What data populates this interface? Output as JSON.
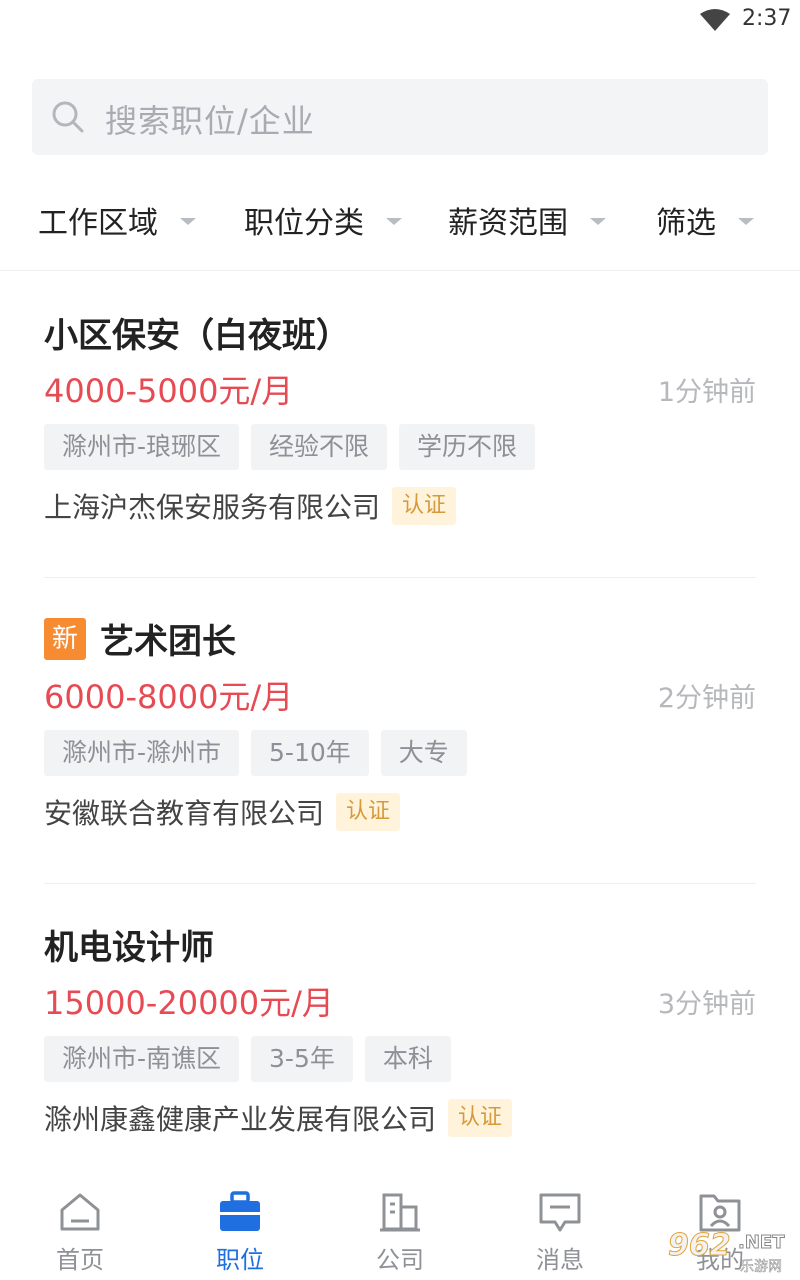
{
  "status_bar": {
    "time": "2:37",
    "wifi_icon": "wifi-icon"
  },
  "search": {
    "placeholder": "搜索职位/企业",
    "icon": "search-icon"
  },
  "filters": [
    {
      "label": "工作区域"
    },
    {
      "label": "职位分类"
    },
    {
      "label": "薪资范围"
    },
    {
      "label": "筛选"
    }
  ],
  "jobs": [
    {
      "title": "小区保安（白夜班）",
      "is_new": false,
      "salary": "4000-5000元/月",
      "posted": "1分钟前",
      "tags": [
        "滁州市-琅琊区",
        "经验不限",
        "学历不限"
      ],
      "company": "上海沪杰保安服务有限公司",
      "verified_label": "认证"
    },
    {
      "title": "艺术团长",
      "is_new": true,
      "new_label": "新",
      "salary": "6000-8000元/月",
      "posted": "2分钟前",
      "tags": [
        "滁州市-滁州市",
        "5-10年",
        "大专"
      ],
      "company": "安徽联合教育有限公司",
      "verified_label": "认证"
    },
    {
      "title": "机电设计师",
      "is_new": false,
      "salary": "15000-20000元/月",
      "posted": "3分钟前",
      "tags": [
        "滁州市-南谯区",
        "3-5年",
        "本科"
      ],
      "company": "滁州康鑫健康产业发展有限公司",
      "verified_label": "认证"
    }
  ],
  "bottom_nav": [
    {
      "label": "首页",
      "icon": "home-icon",
      "active": false
    },
    {
      "label": "职位",
      "icon": "briefcase-icon",
      "active": true
    },
    {
      "label": "公司",
      "icon": "building-icon",
      "active": false
    },
    {
      "label": "消息",
      "icon": "message-icon",
      "active": false
    },
    {
      "label": "我的",
      "icon": "profile-folder-icon",
      "active": false
    }
  ],
  "colors": {
    "accent": "#1f6fe0",
    "salary": "#e64b54",
    "new_badge": "#f78b32",
    "verified_bg": "#fff3dc",
    "verified_text": "#d69a3a"
  },
  "watermark": {
    "number": "962",
    "suffix": ".NET",
    "subtitle": "乐游网"
  }
}
